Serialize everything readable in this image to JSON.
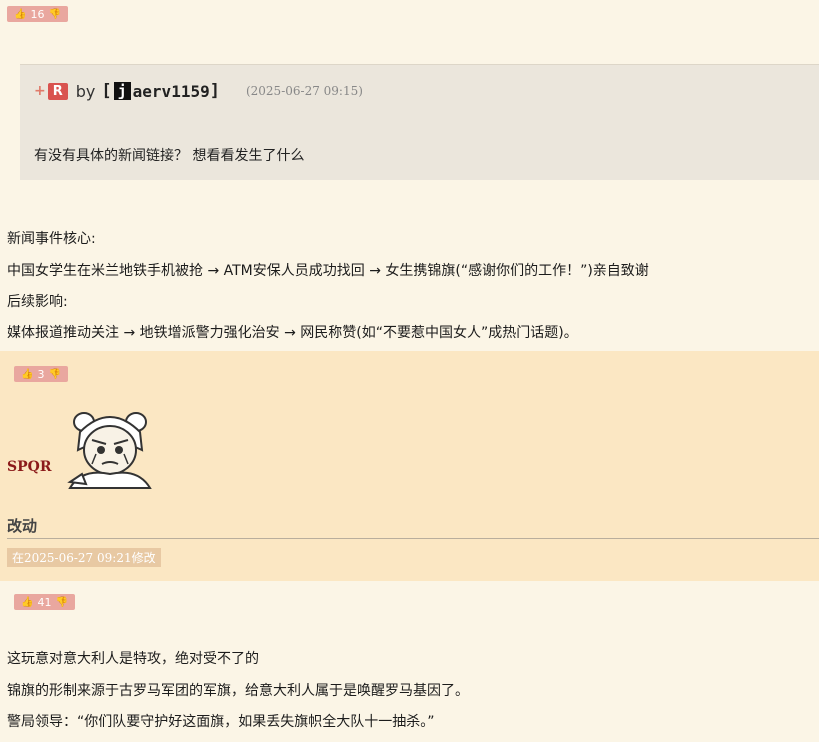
{
  "post1": {
    "votes": "16"
  },
  "quote": {
    "plus": "+",
    "badge": "R",
    "by": "by",
    "bracket_open": "[",
    "avatar_letter": "j",
    "username": "aerv1159",
    "bracket_close": "]",
    "time": "(2025-06-27 09:15)",
    "text": "有没有具体的新闻链接？ 想看看发生了什么"
  },
  "reply1": {
    "lines": [
      "新闻事件核心:",
      "中国女学生在米兰地铁手机被抢 → ATM安保人员成功找回 → 女生携锦旗(“感谢你们的工作！”)亲自致谢",
      "后续影响:",
      "媒体报道推动关注 → 地铁增派警力强化治安 → 网民称赞(如“不要惹中国女人”成热门话题)。"
    ]
  },
  "post2": {
    "votes": "3",
    "author": "SPQR",
    "title": "改动",
    "edited": "在2025-06-27 09:21修改"
  },
  "post3": {
    "votes": "41",
    "lines": [
      "这玩意对意大利人是特攻，绝对受不了的",
      "锦旗的形制来源于古罗马军团的军旗，给意大利人属于是唤醒罗马基因了。",
      "警局领导：“你们队要守护好这面旗，如果丢失旗帜全大队十一抽杀。”"
    ]
  },
  "colors": {
    "vote_badge": "#e9a79f",
    "author": "#8b1a1a",
    "post_highlight": "#fbe7c3",
    "quote_bg": "#ebe6dc"
  }
}
